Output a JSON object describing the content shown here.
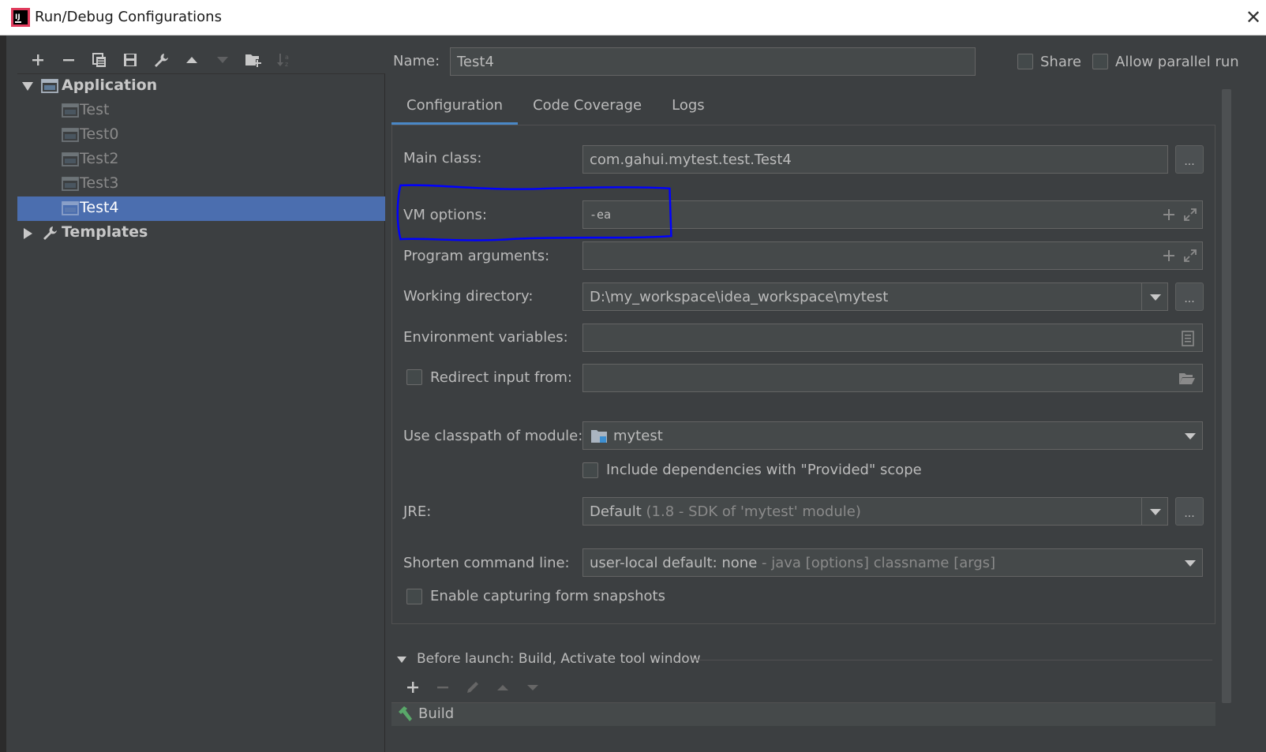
{
  "window": {
    "title": "Run/Debug Configurations"
  },
  "toolbar": {
    "buttons": [
      "add-icon",
      "remove-icon",
      "copy-icon",
      "save-icon",
      "wrench-icon",
      "move-up-icon",
      "move-down-icon",
      "folder-add-icon",
      "sort-icon"
    ]
  },
  "tree": {
    "application": "Application",
    "children": [
      "Test",
      "Test0",
      "Test2",
      "Test3",
      "Test4"
    ],
    "selected": "Test4",
    "templates": "Templates"
  },
  "header": {
    "name_label": "Name:",
    "name_value": "Test4",
    "share_label": "Share",
    "parallel_label": "Allow parallel run"
  },
  "tabs": [
    "Configuration",
    "Code Coverage",
    "Logs"
  ],
  "config": {
    "main_class_label": "Main class:",
    "main_class_value": "com.gahui.mytest.test.Test4",
    "vm_label": "VM options:",
    "vm_value": "-ea",
    "program_args_label": "Program arguments:",
    "program_args_value": "",
    "working_dir_label": "Working directory:",
    "working_dir_value": "D:\\my_workspace\\idea_workspace\\mytest",
    "env_label": "Environment variables:",
    "env_value": "",
    "redirect_label": "Redirect input from:",
    "redirect_value": "",
    "classpath_label": "Use classpath of module:",
    "classpath_value": "mytest",
    "include_deps_label": "Include dependencies with \"Provided\" scope",
    "jre_label": "JRE:",
    "jre_value": "Default",
    "jre_detail": "(1.8 - SDK of 'mytest' module)",
    "shorten_label": "Shorten command line:",
    "shorten_value": "user-local default: none",
    "shorten_detail": "- java [options] classname [args]",
    "snapshots_label": "Enable capturing form snapshots",
    "browse_label": "..."
  },
  "before_launch": {
    "title": "Before launch: Build, Activate tool window",
    "items": [
      "Build"
    ]
  },
  "colors": {
    "background": "#3c3f41",
    "selection": "#4b6eaf",
    "tab_underline": "#4a88c7",
    "annotation": "#0000ff"
  }
}
